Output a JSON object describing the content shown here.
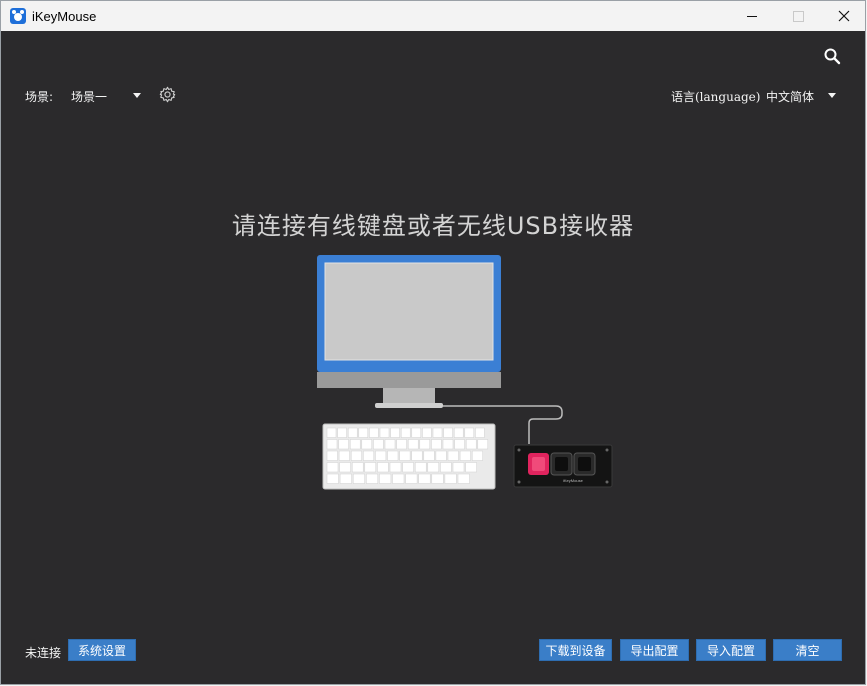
{
  "window": {
    "title": "iKeyMouse",
    "icons": [
      "app-logo-icon",
      "minimize-icon",
      "maximize-icon",
      "close-icon"
    ]
  },
  "header": {
    "scene_label": "场景:",
    "scene_value": "场景一",
    "language_label": "语言(language)",
    "language_value": "中文简体",
    "icons": [
      "search-icon",
      "gear-icon",
      "chevron-down-icon"
    ]
  },
  "main": {
    "prompt": "请连接有线键盘或者无线USB接收器",
    "device_brand": "iKeyMouse"
  },
  "footer": {
    "status": "未连接",
    "system_settings": "系统设置",
    "download": "下载到设备",
    "export": "导出配置",
    "import": "导入配置",
    "clear": "清空"
  },
  "colors": {
    "background": "#2b2a2c",
    "button": "#3a7ec8",
    "monitor_frame": "#3b7fd4",
    "device_key_active": "#e0245e"
  }
}
